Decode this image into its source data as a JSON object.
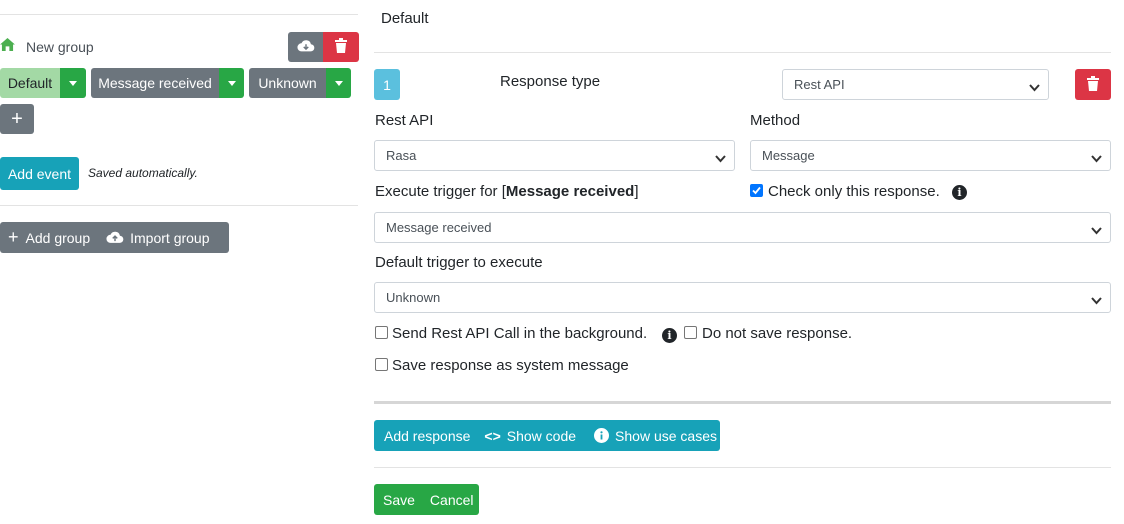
{
  "sidebar": {
    "group_name": "New group",
    "triggers": [
      {
        "label": "Default"
      },
      {
        "label": "Message received"
      },
      {
        "label": "Unknown"
      }
    ],
    "add_trigger_label": "+",
    "add_event_label": "Add event",
    "saved_note": "Saved automatically.",
    "add_group_label": "Add group",
    "import_group_label": "Import group"
  },
  "main": {
    "title": "Default",
    "response": {
      "number": "1",
      "type_label": "Response type",
      "type_value": "Rest API",
      "rest_api_label": "Rest API",
      "rest_api_value": "Rasa",
      "method_label": "Method",
      "method_value": "Message",
      "execute_prefix": "Execute trigger for [",
      "execute_name": "Message received",
      "execute_suffix": "]",
      "check_only_label": "Check only this response.",
      "execute_value": "Message received",
      "default_trigger_label": "Default trigger to execute",
      "default_trigger_value": "Unknown",
      "background_label": "Send Rest API Call in the background.",
      "no_save_label": "Do not save response.",
      "save_system_label": "Save response as system message"
    },
    "actions": {
      "add_response": "Add response",
      "show_code": "Show code",
      "show_use_cases": "Show use cases"
    },
    "footer": {
      "save": "Save",
      "cancel": "Cancel"
    }
  },
  "colors": {
    "green": "#28a745",
    "teal": "#17a2b8",
    "red": "#dc3545",
    "gray": "#6c757d",
    "checkbox": "#0075ff"
  }
}
